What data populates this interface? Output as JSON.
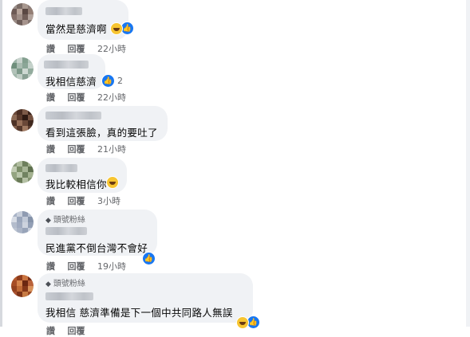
{
  "comments": [
    {
      "text": "當然是慈濟啊",
      "badge": "",
      "reactions": "",
      "actions": {
        "like": "讚",
        "reply": "回覆",
        "time": "22小時"
      }
    },
    {
      "text": "我相信慈濟",
      "badge": "",
      "reactions": "2",
      "actions": {
        "like": "讚",
        "reply": "回覆",
        "time": "22小時"
      }
    },
    {
      "text": "看到這張臉，真的要吐了",
      "badge": "",
      "reactions": "",
      "actions": {
        "like": "讚",
        "reply": "回覆",
        "time": "21小時"
      }
    },
    {
      "text": "我比較相信你",
      "badge": "",
      "reactions": "",
      "actions": {
        "like": "讚",
        "reply": "回覆",
        "time": "3小時"
      }
    },
    {
      "text": "民進黨不倒台灣不會好",
      "badge": "頭號粉絲",
      "reactions": "",
      "actions": {
        "like": "讚",
        "reply": "回覆",
        "time": "19小時"
      }
    },
    {
      "text": "我相信 慈濟準備是下一個中共同路人無誤",
      "badge": "頭號粉絲",
      "reactions": "",
      "actions": {
        "like": "讚",
        "reply": "回覆",
        "time": ""
      }
    }
  ],
  "icons": {
    "like": "like-icon",
    "haha": "haha-icon",
    "badge": "diamond-badge-icon"
  }
}
